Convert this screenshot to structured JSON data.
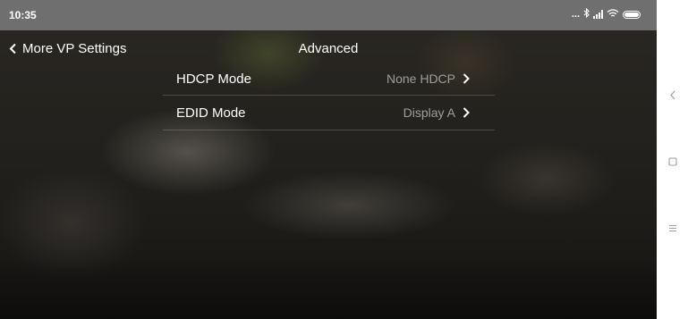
{
  "status_bar": {
    "time": "10:35",
    "dots": "...",
    "bluetooth_icon": "bluetooth-icon",
    "signal_icon": "signal-icon",
    "wifi_icon": "wifi-icon",
    "battery_icon": "battery-icon"
  },
  "header": {
    "back_label": "More VP Settings",
    "title": "Advanced"
  },
  "settings": {
    "items": [
      {
        "label": "HDCP Mode",
        "value": "None HDCP"
      },
      {
        "label": "EDID Mode",
        "value": "Display A"
      }
    ]
  },
  "nav_bar": {
    "back_icon": "nav-back-icon",
    "home_icon": "nav-home-icon",
    "recents_icon": "nav-menu-icon"
  },
  "colors": {
    "status_bar": "#6f6f6f",
    "text_primary": "#ffffff",
    "text_secondary": "#9e9e9e",
    "divider": "rgba(255,255,255,0.18)",
    "nav_bar": "#ffffff",
    "nav_icon": "#9e9e9e"
  }
}
